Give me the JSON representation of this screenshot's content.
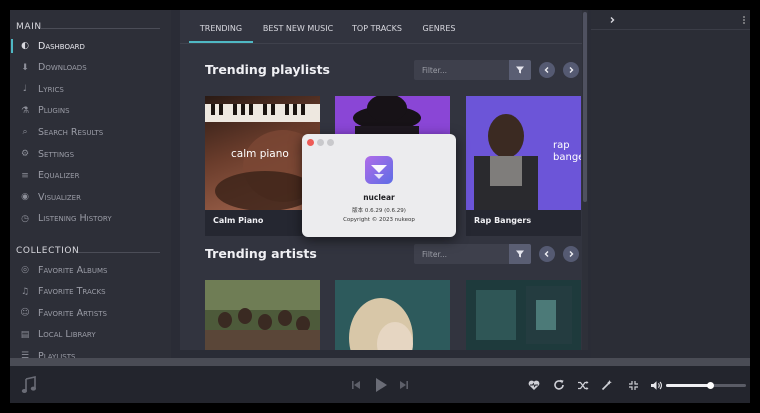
{
  "sidebar": {
    "main_label": "MAIN",
    "collection_label": "COLLECTION",
    "main_items": [
      {
        "label": "Dashboard",
        "icon": "dashboard-icon"
      },
      {
        "label": "Downloads",
        "icon": "download-icon"
      },
      {
        "label": "Lyrics",
        "icon": "microphone-icon"
      },
      {
        "label": "Plugins",
        "icon": "flask-icon"
      },
      {
        "label": "Search Results",
        "icon": "search-icon"
      },
      {
        "label": "Settings",
        "icon": "gear-icon"
      },
      {
        "label": "Equalizer",
        "icon": "equalizer-icon"
      },
      {
        "label": "Visualizer",
        "icon": "droplet-icon"
      },
      {
        "label": "Listening History",
        "icon": "history-icon"
      }
    ],
    "collection_items": [
      {
        "label": "Favorite Albums",
        "icon": "album-icon"
      },
      {
        "label": "Favorite Tracks",
        "icon": "music-note-icon"
      },
      {
        "label": "Favorite Artists",
        "icon": "user-icon"
      },
      {
        "label": "Local Library",
        "icon": "folder-icon"
      },
      {
        "label": "Playlists",
        "icon": "list-icon"
      }
    ]
  },
  "tabs": [
    "TRENDING",
    "BEST NEW MUSIC",
    "TOP TRACKS",
    "GENRES"
  ],
  "trending_playlists": {
    "heading": "Trending playlists",
    "filter_placeholder": "Filter...",
    "cards": [
      {
        "name": "Calm Piano",
        "art_text": "calm piano"
      },
      {
        "name": "",
        "art_text": ""
      },
      {
        "name": "Rap Bangers",
        "art_text": "rap\nbangers"
      }
    ]
  },
  "trending_artists": {
    "heading": "Trending artists",
    "filter_placeholder": "Filter..."
  },
  "about_dialog": {
    "app_name": "nuclear",
    "version": "版本 0.6.29 (0.6.29)",
    "copyright": "Copyright © 2023 nukeop"
  },
  "player": {
    "volume_fraction": 0.55
  },
  "colors": {
    "accent": "#4fb8c4",
    "sidebar_bg": "#2d2f38",
    "main_bg": "#32343f",
    "player_bg": "#23252d"
  }
}
